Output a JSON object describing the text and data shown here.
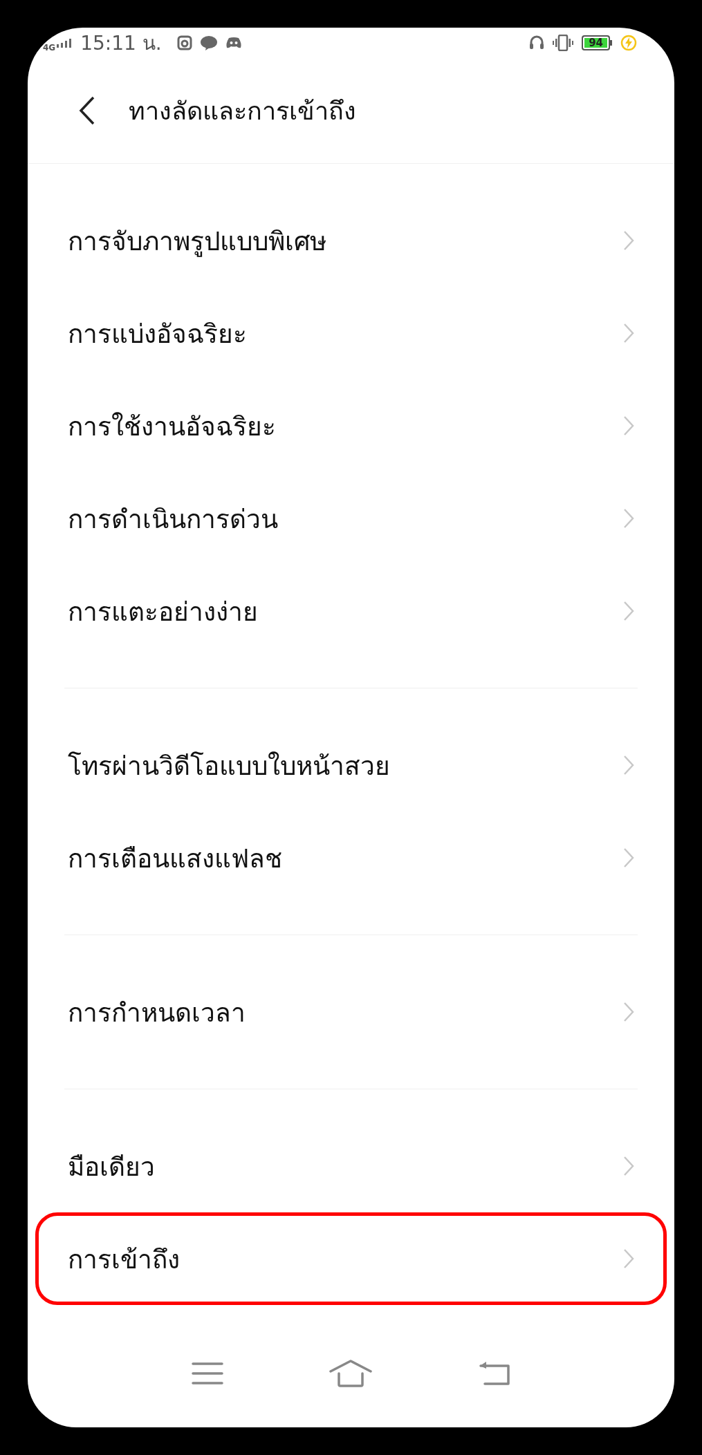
{
  "status_bar": {
    "network": "4G",
    "time": "15:11 น.",
    "battery": "94"
  },
  "header": {
    "title": "ทางลัดและการเข้าถึง"
  },
  "sections": [
    {
      "items": [
        {
          "label": "การจับภาพรูปแบบพิเศษ",
          "highlighted": false
        },
        {
          "label": "การแบ่งอัจฉริยะ",
          "highlighted": false
        },
        {
          "label": "การใช้งานอัจฉริยะ",
          "highlighted": false
        },
        {
          "label": "การดำเนินการด่วน",
          "highlighted": false
        },
        {
          "label": "การแตะอย่างง่าย",
          "highlighted": false
        }
      ]
    },
    {
      "items": [
        {
          "label": "โทรผ่านวิดีโอแบบใบหน้าสวย",
          "highlighted": false
        },
        {
          "label": "การเตือนแสงแฟลช",
          "highlighted": false
        }
      ]
    },
    {
      "items": [
        {
          "label": "การกำหนดเวลา",
          "highlighted": false
        }
      ]
    },
    {
      "items": [
        {
          "label": "มือเดียว",
          "highlighted": false
        },
        {
          "label": "การเข้าถึง",
          "highlighted": true
        }
      ]
    }
  ]
}
